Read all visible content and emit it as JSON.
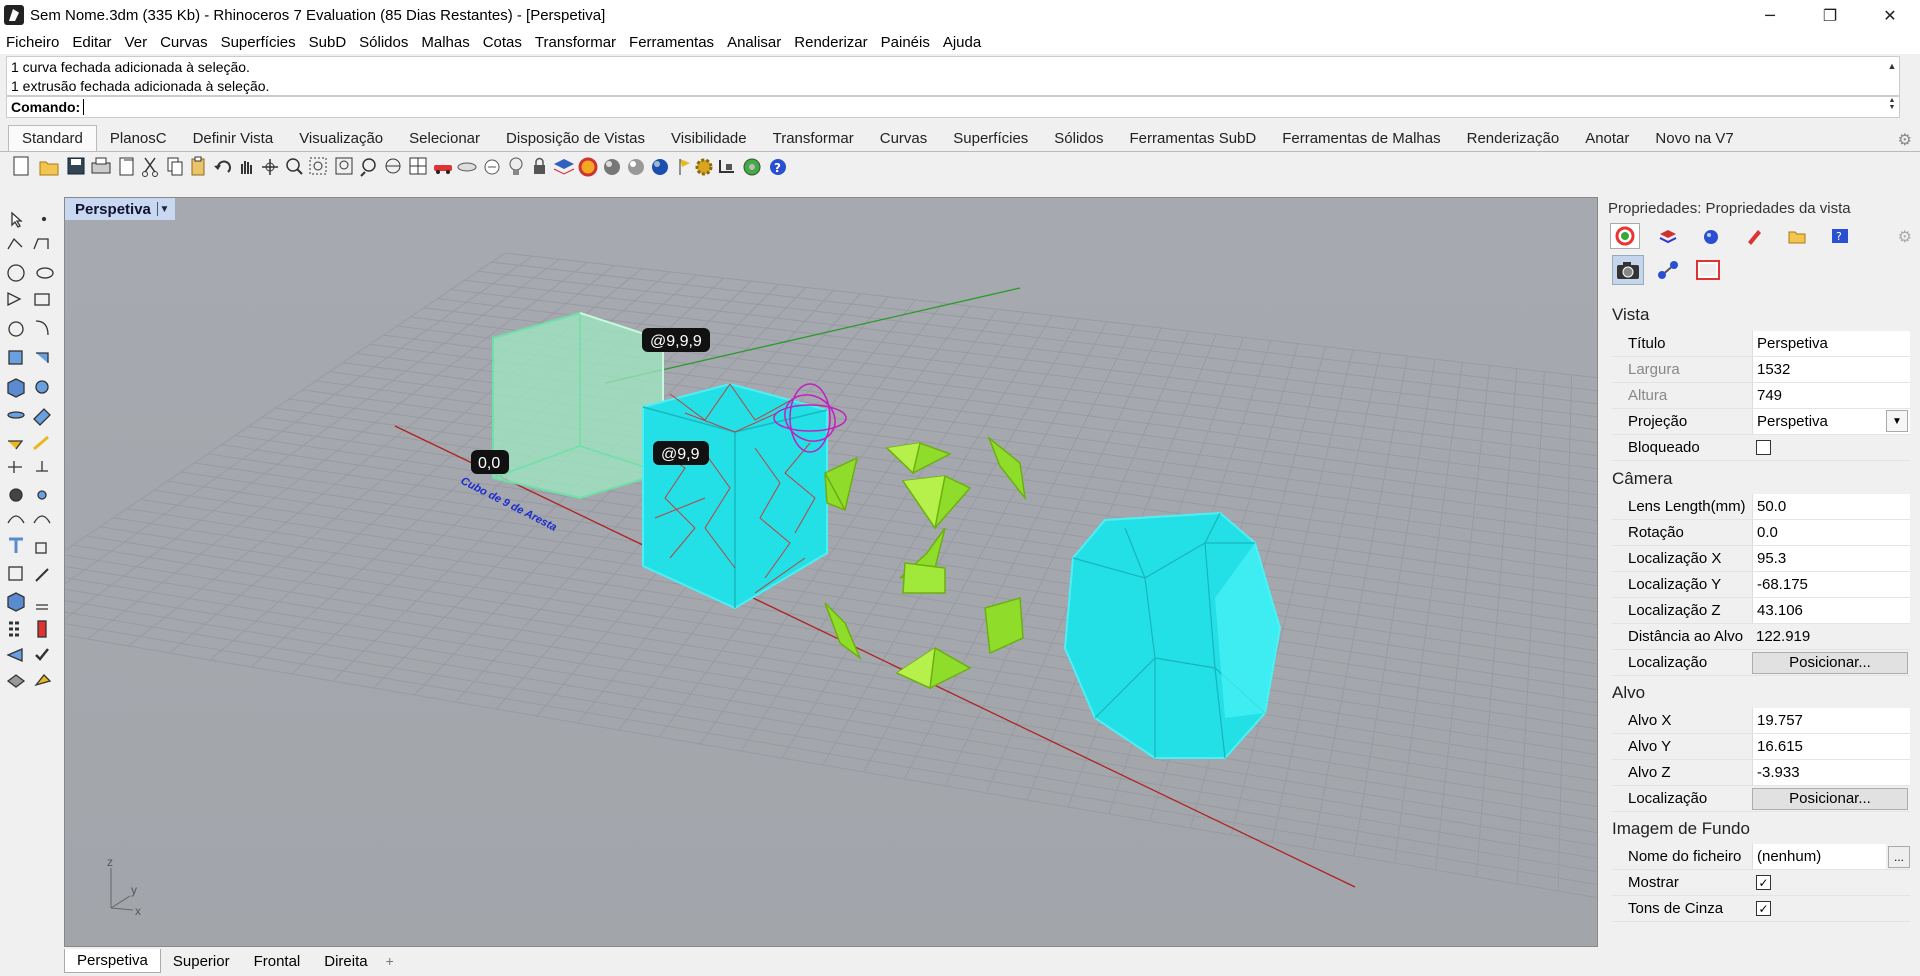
{
  "window": {
    "title": "Sem Nome.3dm (335 Kb) - Rhinoceros 7 Evaluation (85 Dias Restantes) - [Perspetiva]",
    "minimize": "─",
    "restore": "❐",
    "close": "✕"
  },
  "menu": [
    "Ficheiro",
    "Editar",
    "Ver",
    "Curvas",
    "Superfícies",
    "SubD",
    "Sólidos",
    "Malhas",
    "Cotas",
    "Transformar",
    "Ferramentas",
    "Analisar",
    "Renderizar",
    "Painéis",
    "Ajuda"
  ],
  "command": {
    "history": [
      "1 curva fechada adicionada à seleção.",
      "1 extrusão fechada adicionada à seleção."
    ],
    "label": "Comando:",
    "value": ""
  },
  "toolbar_tabs": [
    "Standard",
    "PlanosC",
    "Definir Vista",
    "Visualização",
    "Selecionar",
    "Disposição de Vistas",
    "Visibilidade",
    "Transformar",
    "Curvas",
    "Superfícies",
    "Sólidos",
    "Ferramentas SubD",
    "Ferramentas de Malhas",
    "Renderização",
    "Anotar",
    "Novo na V7"
  ],
  "toolbar_icons": [
    "new-icon",
    "open-icon",
    "save-icon",
    "print-icon",
    "import-icon",
    "cut-icon",
    "copy-icon",
    "paste-icon",
    "undo-icon",
    "pan-icon",
    "rotate-view-icon",
    "zoom-icon",
    "zoom-window-icon",
    "zoom-extents-icon",
    "zoom-selected-icon",
    "named-views-icon",
    "four-views-icon",
    "car-icon",
    "cplane-icon",
    "osnap-icon",
    "light-icon",
    "lock-icon",
    "layer-icon",
    "color-wheel-icon",
    "sphere-icon",
    "render-sphere-icon",
    "blue-sphere-icon",
    "flag-icon",
    "gear-icon",
    "gumball-icon",
    "globe-icon",
    "help-icon"
  ],
  "viewport": {
    "name": "Perspetiva",
    "dropdown": "▼",
    "labels": {
      "origin": "0,0",
      "box_corner": "@9,9,9",
      "box_diag": "@9,9",
      "text": "Cubo de 9 de Aresta"
    },
    "axis": {
      "z": "z",
      "y": "y",
      "x": "x"
    }
  },
  "viewport_tabs": [
    "Perspetiva",
    "Superior",
    "Frontal",
    "Direita"
  ],
  "viewport_add": "+",
  "panel": {
    "title": "Propriedades: Propriedades da vista",
    "gear": "⚙",
    "sections": {
      "vista": "Vista",
      "camera": "Câmera",
      "alvo": "Alvo",
      "fundo": "Imagem de Fundo"
    },
    "vista": {
      "titulo_label": "Título",
      "titulo": "Perspetiva",
      "largura_label": "Largura",
      "largura": "1532",
      "altura_label": "Altura",
      "altura": "749",
      "projecao_label": "Projeção",
      "projecao": "Perspetiva",
      "bloqueado_label": "Bloqueado"
    },
    "camera": {
      "lens_label": "Lens Length(mm)",
      "lens": "50.0",
      "rotacao_label": "Rotação",
      "rotacao": "0.0",
      "locx_label": "Localização X",
      "locx": "95.3",
      "locy_label": "Localização Y",
      "locy": "-68.175",
      "locz_label": "Localização Z",
      "locz": "43.106",
      "dist_label": "Distância ao Alvo",
      "dist": "122.919",
      "loc_label": "Localização",
      "loc_button": "Posicionar..."
    },
    "alvo": {
      "x_label": "Alvo X",
      "x": "19.757",
      "y_label": "Alvo Y",
      "y": "16.615",
      "z_label": "Alvo Z",
      "z": "-3.933",
      "loc_label": "Localização",
      "loc_button": "Posicionar..."
    },
    "fundo": {
      "ficheiro_label": "Nome do ficheiro",
      "ficheiro": "(nenhum)",
      "browse": "...",
      "mostrar_label": "Mostrar",
      "mostrar": true,
      "cinza_label": "Tons de Cinza",
      "cinza": true
    }
  },
  "colors": {
    "viewport_bg": "#a4a8ad",
    "cyan": "#22e0e6",
    "green_box": "#9ee8c0",
    "lime": "#8fdc2a",
    "x_axis": "#b02020",
    "y_axis": "#2a9a2a"
  }
}
